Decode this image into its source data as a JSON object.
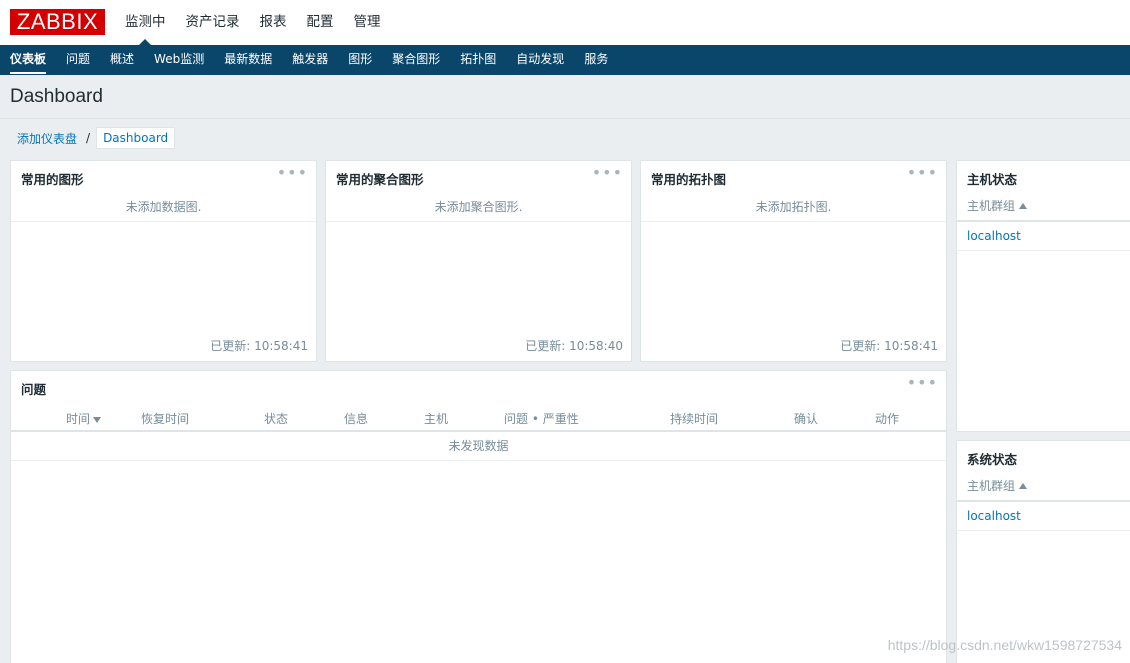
{
  "logo": "ZABBIX",
  "top_nav": [
    "监测中",
    "资产记录",
    "报表",
    "配置",
    "管理"
  ],
  "sub_nav": [
    "仪表板",
    "问题",
    "概述",
    "Web监测",
    "最新数据",
    "触发器",
    "图形",
    "聚合图形",
    "拓扑图",
    "自动发现",
    "服务"
  ],
  "page_title": "Dashboard",
  "breadcrumb": {
    "link": "添加仪表盘",
    "separator": "/",
    "current": "Dashboard"
  },
  "widgets": {
    "fav_graphs": {
      "title": "常用的图形",
      "empty": "未添加数据图.",
      "updated": "已更新: 10:58:41"
    },
    "fav_screens": {
      "title": "常用的聚合图形",
      "empty": "未添加聚合图形.",
      "updated": "已更新: 10:58:40"
    },
    "fav_maps": {
      "title": "常用的拓扑图",
      "empty": "未添加拓扑图.",
      "updated": "已更新: 10:58:41"
    },
    "problems": {
      "title": "问题",
      "columns": [
        "时间",
        "恢复时间",
        "状态",
        "信息",
        "主机",
        "问题 • 严重性",
        "持续时间",
        "确认",
        "动作"
      ],
      "no_data": "未发现数据"
    },
    "host_status": {
      "title": "主机状态",
      "column": "主机群组",
      "rows": [
        "localhost"
      ]
    },
    "system_status": {
      "title": "系统状态",
      "column": "主机群组",
      "rows": [
        "localhost"
      ]
    }
  },
  "watermark": "https://blog.csdn.net/wkw1598727534",
  "colors": {
    "brand": "#d40000",
    "nav_bg": "#0a466a",
    "link": "#0275b8",
    "page_bg": "#ebeef0"
  },
  "icons": [
    "ellipsis-menu-icon",
    "sort-asc-icon",
    "sort-desc-icon"
  ]
}
